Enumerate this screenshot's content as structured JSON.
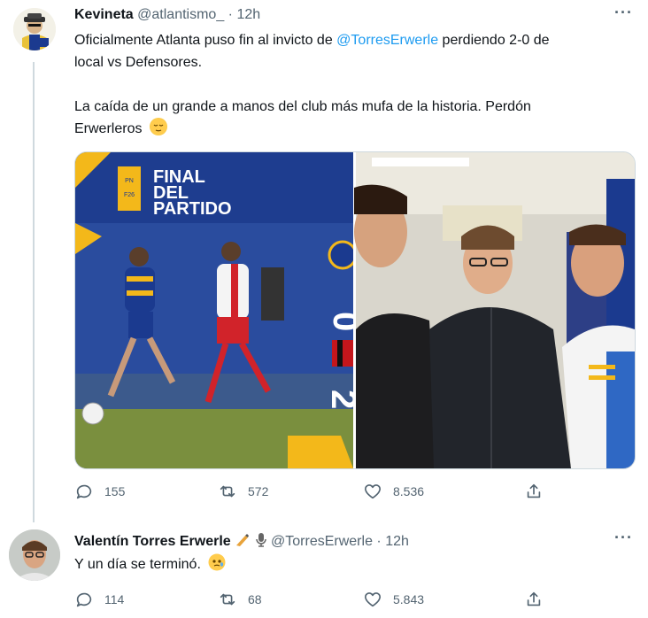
{
  "tweet1": {
    "display_name": "Kevineta",
    "handle": "@atlantismo_",
    "separator": "·",
    "time": "12h",
    "line1_pre": "Oficialmente Atlanta puso fin al invicto de ",
    "mention": "@TorresErwerle",
    "line1_post": " perdiendo 2-0 de",
    "line2": "local vs Defensores.",
    "line3": "La caída de un grande a manos del club más mufa de la historia. Perdón",
    "line4": "Erwerleros",
    "emoji": "relieved-face",
    "media_left": {
      "badge_pn": "PN",
      "badge_f26": "F26",
      "title_line1": "FINAL",
      "title_line2": "DEL",
      "title_line3": "PARTIDO",
      "score_home": "0",
      "score_away": "2"
    },
    "stats": {
      "replies": "155",
      "retweets": "572",
      "likes": "8.536"
    }
  },
  "tweet2": {
    "display_name": "Valentín Torres Erwerle",
    "handle": "@TorresErwerle",
    "separator": "·",
    "time": "12h",
    "text": "Y un día se terminó.",
    "emoji": "face-holding-back-tears",
    "stats": {
      "replies": "114",
      "retweets": "68",
      "likes": "5.843"
    }
  },
  "colors": {
    "accent": "#1d9bf0",
    "muted": "#536471",
    "atlanta_blue": "#1b3a8f",
    "atlanta_yellow": "#f3b81a"
  },
  "icons": [
    "reply-icon",
    "retweet-icon",
    "like-icon",
    "share-icon",
    "more-icon",
    "writing-hand-icon",
    "microphone-icon"
  ]
}
